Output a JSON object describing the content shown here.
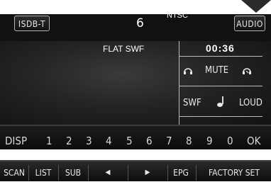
{
  "header": {
    "source_label": "ISDB-T",
    "channel": "6",
    "video_format": "NTSC",
    "audio_label": "AUDIO"
  },
  "display": {
    "track_title": "FLAT SWF",
    "elapsed_time": "00:36"
  },
  "controls": {
    "vol_down_icon": "headphone-left-icon",
    "mute_label": "MUTE",
    "vol_up_icon": "headphone-right-icon",
    "swf_label": "SWF",
    "note_icon": "music-note-icon",
    "loud_label": "LOUD"
  },
  "keypad": {
    "disp_label": "DISP",
    "digits": [
      "1",
      "2",
      "3",
      "4",
      "5",
      "6",
      "7",
      "8",
      "9",
      "0"
    ],
    "ok_label": "OK"
  },
  "bottom_bar": {
    "scan": "SCAN",
    "list": "LIST",
    "sub": "SUB",
    "prev": "◀",
    "next": "▶",
    "epg": "EPG",
    "factory_set": "FACTORY SET"
  },
  "colors": {
    "background": "#111111",
    "text": "#eaeaea",
    "border": "#b5b5b5"
  }
}
